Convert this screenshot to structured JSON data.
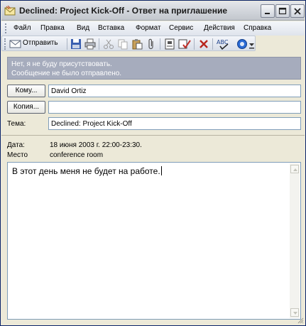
{
  "window": {
    "title": "Declined: Project Kick-Off - Ответ на приглашение",
    "minimize_icon": "minimize-icon",
    "maximize_icon": "maximize-icon",
    "close_icon": "close-icon"
  },
  "menu": {
    "items": [
      {
        "label": "Файл"
      },
      {
        "label": "Правка"
      },
      {
        "label": "Вид"
      },
      {
        "label": "Вставка"
      },
      {
        "label": "Формат"
      },
      {
        "label": "Сервис"
      },
      {
        "label": "Действия"
      },
      {
        "label": "Справка"
      }
    ]
  },
  "toolbar": {
    "send_label": "Отправить",
    "icons": [
      "send-icon",
      "save-icon",
      "print-icon",
      "cut-icon",
      "copy-icon",
      "paste-icon",
      "attach-icon",
      "address-book-icon",
      "check-names-icon",
      "delete-icon",
      "spelling-icon",
      "options-icon",
      "toolbar-more-icon"
    ]
  },
  "infobar": {
    "line1": "Нет, я не буду присутствовать.",
    "line2": "Сообщение не было отправлено."
  },
  "fields": {
    "to_label": "Кому...",
    "to_value": "David Ortiz",
    "cc_label": "Копия...",
    "cc_value": "",
    "subject_label": "Тема:",
    "subject_value": "Declined: Project Kick-Off"
  },
  "meeting": {
    "date_label": "Дата:",
    "date_value": "18 июня 2003 г. 22:00-23:30.",
    "location_label": "Место",
    "location_value": "conference room"
  },
  "body": {
    "text": "В этот день меня не будет на работе."
  },
  "colors": {
    "infobar_bg": "#a6acbd",
    "window_bg": "#ece9d8",
    "field_border": "#7f9db9"
  }
}
